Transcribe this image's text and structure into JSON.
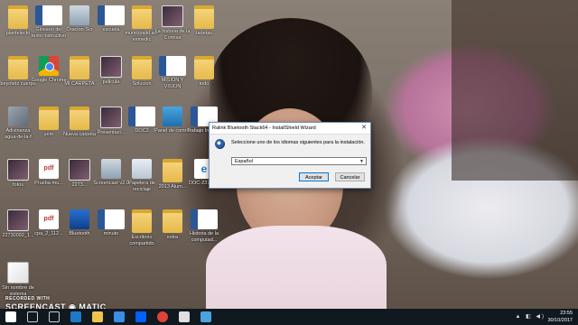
{
  "desktop_icons": [
    {
      "label": "plantelecto",
      "type": "folder"
    },
    {
      "label": "Glosario del texto instructivo",
      "type": "word"
    },
    {
      "label": "Oracion-Scr",
      "type": "setup"
    },
    {
      "label": "escuela",
      "type": "word"
    },
    {
      "label": "municipalid ad-esmedic",
      "type": "folder"
    },
    {
      "label": "La historia de la Comisa",
      "type": "photo"
    },
    {
      "label": "tarjetas",
      "type": "folder"
    },
    {
      "label": "beyotetz cuerpo",
      "type": "folder"
    },
    {
      "label": "Google Chrome",
      "type": "chrome"
    },
    {
      "label": "MI CARPETA",
      "type": "folder"
    },
    {
      "label": "pelicula",
      "type": "photo"
    },
    {
      "label": "Solucion",
      "type": "folder"
    },
    {
      "label": "MISION Y VISION",
      "type": "word"
    },
    {
      "label": "todo",
      "type": "folder"
    },
    {
      "label": "Adivinanza agua-de-la-f",
      "type": "misc"
    },
    {
      "label": "yem",
      "type": "folder"
    },
    {
      "label": "Nueva carpeta",
      "type": "folder"
    },
    {
      "label": "Presentaci...",
      "type": "photo"
    },
    {
      "label": "DOC2",
      "type": "word"
    },
    {
      "label": "Panel de control",
      "type": "cpl"
    },
    {
      "label": "Trabajo Intere...",
      "type": "word"
    },
    {
      "label": "fotos",
      "type": "photo"
    },
    {
      "label": "Prueba-mu...",
      "type": "pdf"
    },
    {
      "label": "2273...",
      "type": "photo"
    },
    {
      "label": "Screencast v2.0",
      "type": "setup"
    },
    {
      "label": "Papelera de reciclaje",
      "type": "trash"
    },
    {
      "label": "2013 Alum...",
      "type": "folder"
    },
    {
      "label": "DOC-23726...",
      "type": "edge"
    },
    {
      "label": "22730092_1...",
      "type": "photo"
    },
    {
      "label": "cpa_2_112...",
      "type": "pdf"
    },
    {
      "label": "Bluetooth",
      "type": "bt"
    },
    {
      "label": "minuto",
      "type": "word"
    },
    {
      "label": "Escritorio compartido",
      "type": "folder"
    },
    {
      "label": "estra",
      "type": "folder"
    },
    {
      "label": "Historia de la computad...",
      "type": "word"
    },
    {
      "label": "Sin nombre de sistema",
      "type": "paint"
    }
  ],
  "dialog": {
    "title": "Ralink Bluetooth Stack64 - InstallShield Wizard",
    "close": "✕",
    "message": "Seleccione uno de los idiomas siguientes para la instalación.",
    "selected_language": "Español",
    "ok_label": "Aceptar",
    "cancel_label": "Cancelar"
  },
  "watermark": {
    "line1": "RECORDED WITH",
    "line2": "SCREENCAST ◉ MATIC"
  },
  "taskbar": {
    "time": "23:55",
    "date": "30/10/2017",
    "apps": [
      "start",
      "search",
      "task-view",
      "edge",
      "explorer",
      "store",
      "dropbox",
      "chrome",
      "media",
      "app"
    ]
  }
}
